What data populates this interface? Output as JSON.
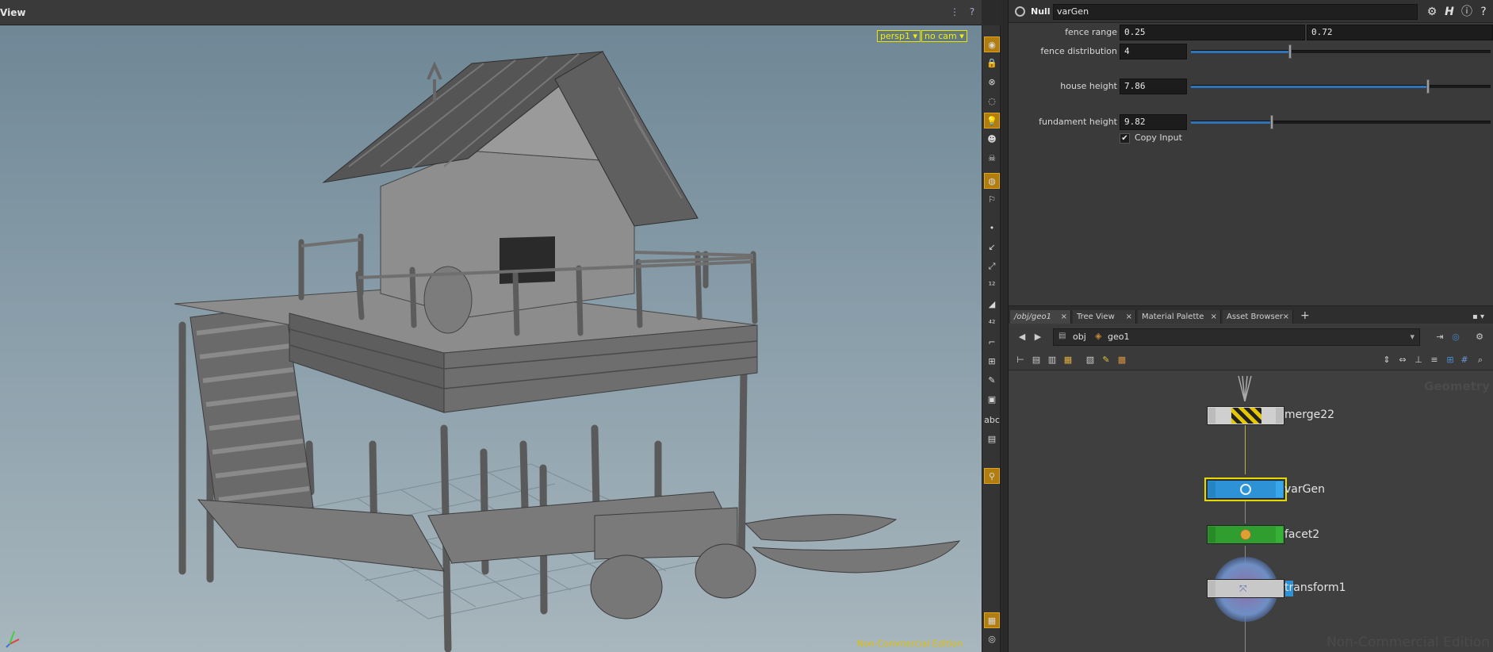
{
  "viewport": {
    "title": "View",
    "camera_button": "persp1",
    "cam_select": "no cam",
    "watermark": "Non-Commercial Edition"
  },
  "parameters": {
    "node_type": "Null",
    "node_name": "varGen",
    "fence_range": {
      "label": "fence range",
      "value_x": "0.25",
      "value_y": "0.72"
    },
    "fence_distribution": {
      "label": "fence distribution",
      "value": "4",
      "slider_fraction": 0.33
    },
    "house_height": {
      "label": "house height",
      "value": "7.86",
      "slider_fraction": 0.79
    },
    "fundament_height": {
      "label": "fundament height",
      "value": "9.82",
      "slider_fraction": 0.27
    },
    "copy_input": {
      "label": "Copy Input",
      "checked": true
    }
  },
  "network": {
    "tabs": [
      {
        "label": "/obj/geo1"
      },
      {
        "label": "Tree View"
      },
      {
        "label": "Material Palette"
      },
      {
        "label": "Asset Browser"
      }
    ],
    "path": {
      "root": "obj",
      "current": "geo1"
    },
    "context_label": "Geometry",
    "watermark": "Non-Commercial Edition",
    "nodes": [
      {
        "name": "merge22",
        "color": "#cfcfcf"
      },
      {
        "name": "varGen",
        "color": "#2d93d6"
      },
      {
        "name": "facet2",
        "color": "#2f9e2f"
      },
      {
        "name": "transform1",
        "color": "#c8c8c8"
      }
    ]
  },
  "colors": {
    "accent_orange": "#b07d0e",
    "selection_yellow": "#e6d800",
    "display_flag_blue": "#2d93d6"
  }
}
